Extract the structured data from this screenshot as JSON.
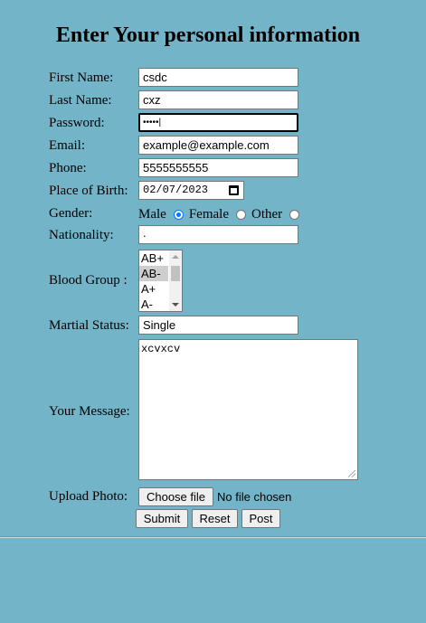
{
  "heading": "Enter Your personal information",
  "labels": {
    "first_name": "First Name:",
    "last_name": "Last Name:",
    "password": "Password:",
    "email": "Email:",
    "phone": "Phone:",
    "place_of_birth": "Place of Birth:",
    "gender": "Gender:",
    "nationality": "Nationality:",
    "blood_group": "Blood Group :",
    "martial_status": "Martial Status:",
    "your_message": "Your Message:",
    "upload_photo": "Upload Photo:"
  },
  "values": {
    "first_name": "csdc",
    "last_name": "cxz",
    "password": "•••••|",
    "email": "example@example.com",
    "phone": "5555555555",
    "place_of_birth": "02/07/2023",
    "nationality": ".",
    "martial_status": "Single",
    "message": "xcvxcv"
  },
  "gender_options": {
    "male": "Male",
    "female": "Female",
    "other": "Other",
    "selected": "Male"
  },
  "blood_group_options": [
    "AB+",
    "AB-",
    "A+",
    "A-"
  ],
  "blood_group_selected": "AB-",
  "file_input": {
    "button_label": "Choose file",
    "status": "No file chosen"
  },
  "buttons": {
    "submit": "Submit",
    "reset": "Reset",
    "post": "Post"
  }
}
